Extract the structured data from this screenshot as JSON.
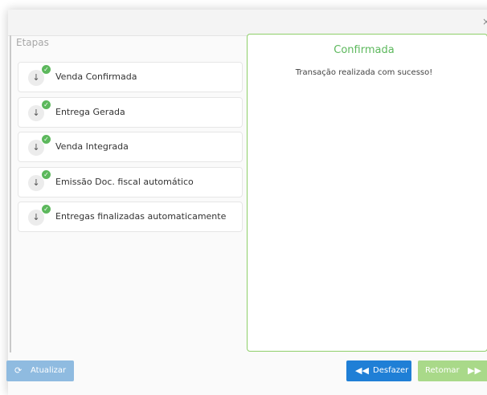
{
  "modal": {
    "close_glyph": "×"
  },
  "steps": {
    "title": "Etapas",
    "items": [
      {
        "label": "Venda Confirmada"
      },
      {
        "label": "Entrega Gerada"
      },
      {
        "label": "Venda Integrada"
      },
      {
        "label": "Emissão Doc. fiscal automático"
      },
      {
        "label": "Entregas finalizadas automaticamente"
      }
    ]
  },
  "detail": {
    "title": "Confirmada",
    "message": "Transação realizada com sucesso!"
  },
  "footer": {
    "refresh_label": "Atualizar",
    "undo_label": "Desfazer",
    "resume_label": "Retomar"
  },
  "colors": {
    "success": "#5cb85c",
    "primary": "#1f7fd6",
    "primary_disabled": "#8fbbe0",
    "success_disabled": "#a9d989"
  }
}
